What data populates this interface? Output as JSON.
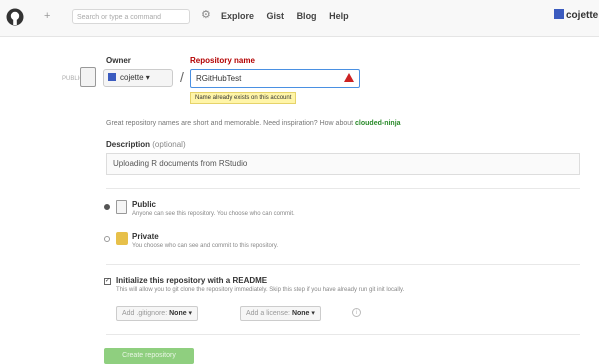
{
  "header": {
    "plus": "+",
    "search_placeholder": "Search or type a command",
    "nav": [
      "Explore",
      "Gist",
      "Blog",
      "Help"
    ],
    "username": "cojette"
  },
  "form": {
    "owner_label": "Owner",
    "repo_label": "Repository name",
    "public_tag": "PUBLIC",
    "owner_value": "cojette ▾",
    "slash": "/",
    "repo_value": "RGitHubTest",
    "repo_error": "Name already exists on this account",
    "hint_text": "Great repository names are short and memorable. Need inspiration? How about",
    "hint_suggestion": "clouded-ninja",
    "desc_label": "Description",
    "desc_optional": "(optional)",
    "desc_value": "Uploading R documents from RStudio",
    "public_title": "Public",
    "public_desc": "Anyone can see this repository. You choose who can commit.",
    "private_title": "Private",
    "private_desc": "You choose who can see and commit to this repository.",
    "init_title": "Initialize this repository with a README",
    "init_desc": "This will allow you to git clone the repository immediately. Skip this step if you have already run git init locally.",
    "gitignore_label": "Add .gitignore:",
    "gitignore_value": "None ▾",
    "license_label": "Add a license:",
    "license_value": "None ▾",
    "info": "i",
    "create_button": "Create repository"
  },
  "colors": {
    "accent": "#4a90e2",
    "error": "#b30000",
    "create": "#8fcf7f"
  }
}
